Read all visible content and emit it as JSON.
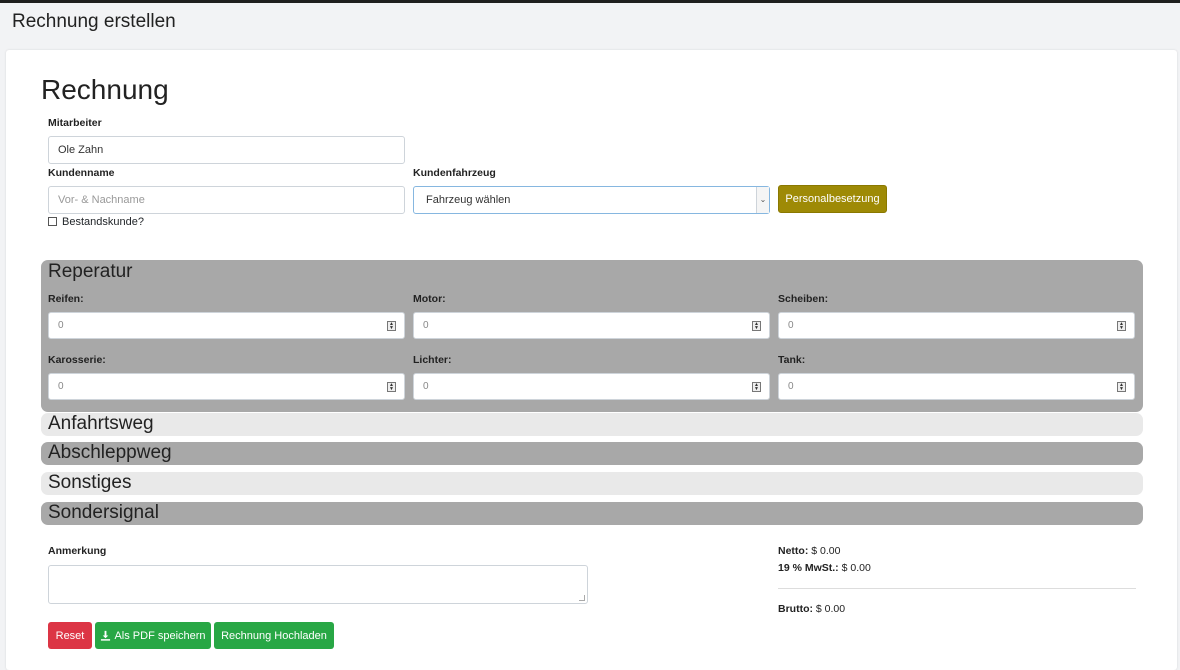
{
  "header": {
    "title": "Rechnung erstellen"
  },
  "form": {
    "title": "Rechnung",
    "mitarbeiter": {
      "label": "Mitarbeiter",
      "value": "Ole Zahn"
    },
    "kundenname": {
      "label": "Kundenname",
      "placeholder": "Vor- & Nachname"
    },
    "bestandskunde": {
      "label": "Bestandskunde?"
    },
    "kundenfahrzeug": {
      "label": "Kundenfahrzeug",
      "selected": "Fahrzeug wählen"
    },
    "personal_button": "Personalbesetzung"
  },
  "sections": {
    "reperatur": {
      "title": "Reperatur",
      "fields": [
        {
          "label": "Reifen:",
          "value": "0"
        },
        {
          "label": "Motor:",
          "value": "0"
        },
        {
          "label": "Scheiben:",
          "value": "0"
        },
        {
          "label": "Karosserie:",
          "value": "0"
        },
        {
          "label": "Lichter:",
          "value": "0"
        },
        {
          "label": "Tank:",
          "value": "0"
        }
      ]
    },
    "anfahrtsweg": {
      "title": "Anfahrtsweg"
    },
    "abschleppweg": {
      "title": "Abschleppweg"
    },
    "sonstiges": {
      "title": "Sonstiges"
    },
    "sondersignal": {
      "title": "Sondersignal"
    }
  },
  "notes": {
    "label": "Anmerkung"
  },
  "summary": {
    "netto_label": "Netto:",
    "netto_value": "$ 0.00",
    "mwst_label": "19 % MwSt.:",
    "mwst_value": "$ 0.00",
    "brutto_label": "Brutto:",
    "brutto_value": "$ 0.00"
  },
  "buttons": {
    "reset": "Reset",
    "pdf": "Als PDF speichern",
    "upload": "Rechnung Hochladen"
  },
  "colors": {
    "accent_olive": "#9e8a06",
    "danger": "#dc3545",
    "success": "#28a745",
    "section_dark": "#a8a8a8",
    "section_light": "#e9e9e9"
  },
  "icons": {
    "pdf_button_icon": "download-icon"
  }
}
